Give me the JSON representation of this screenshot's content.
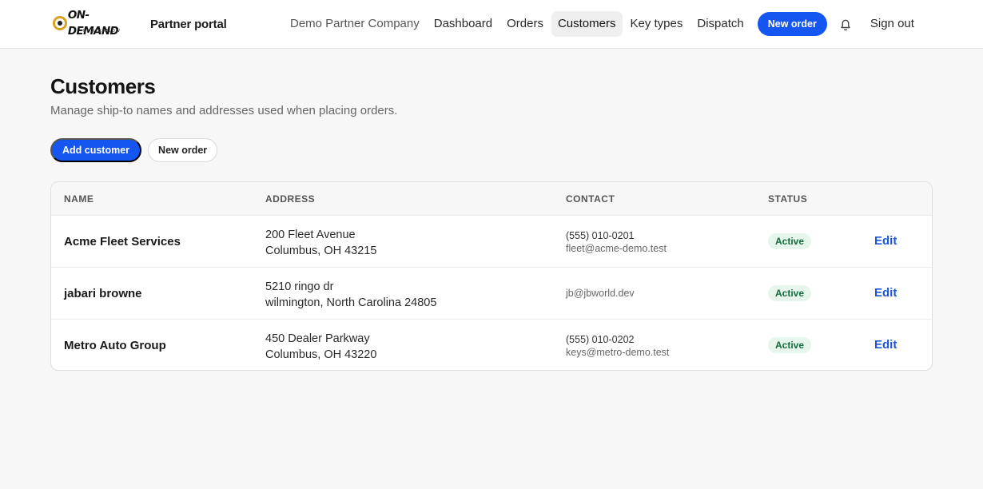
{
  "header": {
    "logo_text": "ON-DEMAND",
    "logo_sub": "BY NEXAFLOW",
    "portal_label": "Partner portal",
    "company": "Demo Partner Company",
    "nav": [
      "Dashboard",
      "Orders",
      "Customers",
      "Key types",
      "Dispatch"
    ],
    "active_nav": "Customers",
    "new_order_label": "New order",
    "sign_out_label": "Sign out"
  },
  "page": {
    "title": "Customers",
    "subtitle": "Manage ship-to names and addresses used when placing orders.",
    "add_customer_label": "Add customer",
    "new_order_label": "New order"
  },
  "table": {
    "columns": [
      "NAME",
      "ADDRESS",
      "CONTACT",
      "STATUS"
    ],
    "rows": [
      {
        "name": "Acme Fleet Services",
        "address_line1": "200 Fleet Avenue",
        "address_line2": "Columbus, OH 43215",
        "phone": "(555) 010-0201",
        "email": "fleet@acme-demo.test",
        "status": "Active",
        "action": "Edit"
      },
      {
        "name": "jabari browne",
        "address_line1": "5210 ringo dr",
        "address_line2": "wilmington, North Carolina 24805",
        "phone": "",
        "email": "jb@jbworld.dev",
        "status": "Active",
        "action": "Edit"
      },
      {
        "name": "Metro Auto Group",
        "address_line1": "450 Dealer Parkway",
        "address_line2": "Columbus, OH 43220",
        "phone": "(555) 010-0202",
        "email": "keys@metro-demo.test",
        "status": "Active",
        "action": "Edit"
      }
    ]
  },
  "colors": {
    "accent": "#1556f0",
    "status_active_bg": "#e6f6ec",
    "status_active_text": "#136b3a",
    "logo_gold": "#d9a321"
  },
  "icons": {
    "notification": "bell-icon"
  }
}
